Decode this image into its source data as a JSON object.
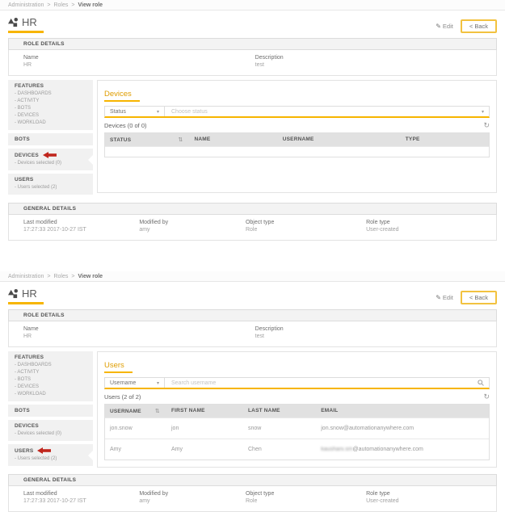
{
  "colors": {
    "accent_underline": "#f7b500",
    "panel_title_text": "#df9d00",
    "back_button_border": "#f2c240",
    "red_annotation_arrow": "#c0261d",
    "table_header_bg": "#e1e1e1",
    "sidebar_section_bg": "#f1f1f1"
  },
  "icons": {
    "pencil": "✎",
    "caret": "▾",
    "refresh": "↻",
    "sort": "⇅"
  },
  "shot1": {
    "breadcrumb": {
      "items": [
        "Administration",
        "Roles",
        "View role"
      ],
      "separator": ">"
    },
    "header": {
      "title": "HR",
      "edit_label": "Edit",
      "back_label": "< Back"
    },
    "role_details": {
      "header": "ROLE DETAILS",
      "fields": [
        {
          "label": "Name",
          "value": "HR"
        },
        {
          "label": "Description",
          "value": "test"
        }
      ]
    },
    "sidebar": {
      "sections": [
        {
          "title": "FEATURES",
          "items": [
            "- DASHBOARDS",
            "- ACTIVITY",
            "- BOTS",
            "- DEVICES",
            "- WORKLOAD"
          ]
        },
        {
          "title": "BOTS"
        },
        {
          "title": "DEVICES",
          "items": [
            "- Devices selected (0)"
          ]
        },
        {
          "title": "USERS",
          "items": [
            "- Users selected (2)"
          ]
        }
      ],
      "active_section": "DEVICES"
    },
    "panel": {
      "title": "Devices",
      "filter": {
        "dropdown_value": "Status",
        "placeholder": "Choose status"
      },
      "count": "Devices (0 of 0)",
      "columns": [
        "STATUS",
        "NAME",
        "USERNAME",
        "TYPE"
      ],
      "rows": []
    },
    "general_details": {
      "header": "GENERAL DETAILS",
      "fields": [
        {
          "label": "Last modified",
          "value": "17:27:33 2017-10-27 IST"
        },
        {
          "label": "Modified by",
          "value": "amy"
        },
        {
          "label": "Object type",
          "value": "Role"
        },
        {
          "label": "Role type",
          "value": "User-created"
        }
      ]
    }
  },
  "shot2": {
    "breadcrumb": {
      "items": [
        "Administration",
        "Roles",
        "View role"
      ],
      "separator": ">"
    },
    "header": {
      "title": "HR",
      "edit_label": "Edit",
      "back_label": "< Back"
    },
    "role_details": {
      "header": "ROLE DETAILS",
      "fields": [
        {
          "label": "Name",
          "value": "HR"
        },
        {
          "label": "Description",
          "value": "test"
        }
      ]
    },
    "sidebar": {
      "sections": [
        {
          "title": "FEATURES",
          "items": [
            "- DASHBOARDS",
            "- ACTIVITY",
            "- BOTS",
            "- DEVICES",
            "- WORKLOAD"
          ]
        },
        {
          "title": "BOTS"
        },
        {
          "title": "DEVICES",
          "items": [
            "- Devices selected (0)"
          ]
        },
        {
          "title": "USERS",
          "items": [
            "- Users selected (2)"
          ]
        }
      ],
      "active_section": "USERS"
    },
    "panel": {
      "title": "Users",
      "filter": {
        "dropdown_value": "Username",
        "placeholder": "Search username"
      },
      "count": "Users (2 of 2)",
      "columns": [
        "USERNAME",
        "FIRST NAME",
        "LAST NAME",
        "EMAIL"
      ],
      "rows": [
        {
          "username": "jon.snow",
          "first_name": "jon",
          "last_name": "snow",
          "email": "jon.snow@automationanywhere.com"
        },
        {
          "username": "Amy",
          "first_name": "Amy",
          "last_name": "Chen",
          "email_local_blurred": "kaushani.sm",
          "email_domain": "@automationanywhere.com"
        }
      ]
    },
    "general_details": {
      "header": "GENERAL DETAILS",
      "fields": [
        {
          "label": "Last modified",
          "value": "17:27:33 2017-10-27 IST"
        },
        {
          "label": "Modified by",
          "value": "amy"
        },
        {
          "label": "Object type",
          "value": "Role"
        },
        {
          "label": "Role type",
          "value": "User-created"
        }
      ]
    }
  }
}
